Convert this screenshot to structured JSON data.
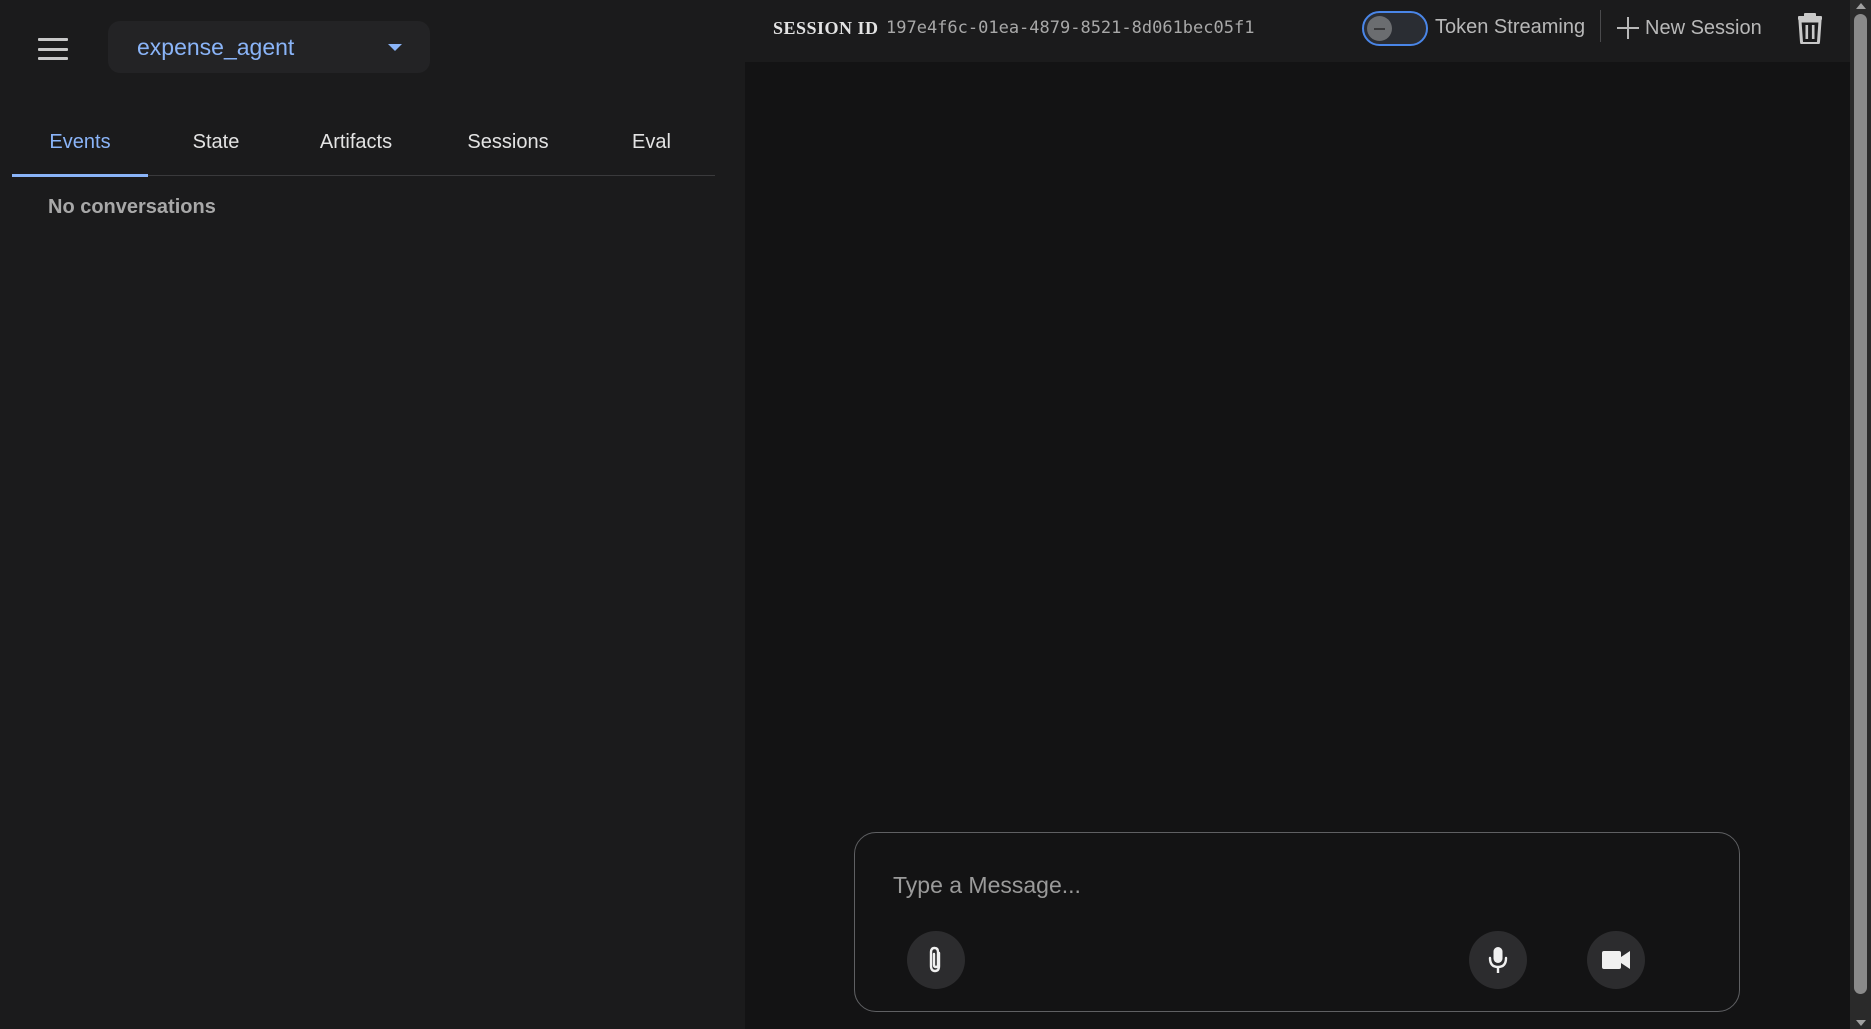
{
  "sidebar": {
    "agent_select": {
      "value": "expense_agent"
    },
    "tabs": [
      {
        "label": "Events",
        "active": true
      },
      {
        "label": "State",
        "active": false
      },
      {
        "label": "Artifacts",
        "active": false
      },
      {
        "label": "Sessions",
        "active": false
      },
      {
        "label": "Eval",
        "active": false
      }
    ],
    "empty_message": "No conversations"
  },
  "header": {
    "session_label": "SESSION ID",
    "session_id": "197e4f6c-01ea-4879-8521-8d061bec05f1",
    "streaming_toggle": {
      "label": "Token Streaming",
      "enabled": false
    },
    "new_session_label": "New Session"
  },
  "composer": {
    "placeholder": "Type a Message...",
    "value": ""
  },
  "icons": {
    "menu": "hamburger-menu-icon",
    "dropdown": "caret-down-icon",
    "new_session": "plus-icon",
    "delete": "trash-icon",
    "attach": "paperclip-icon",
    "mic": "microphone-icon",
    "video": "video-camera-icon"
  },
  "colors": {
    "accent": "#8ab4f8",
    "toggle_border": "#4a86e8",
    "background": "#131314",
    "panel": "#1b1b1c"
  }
}
